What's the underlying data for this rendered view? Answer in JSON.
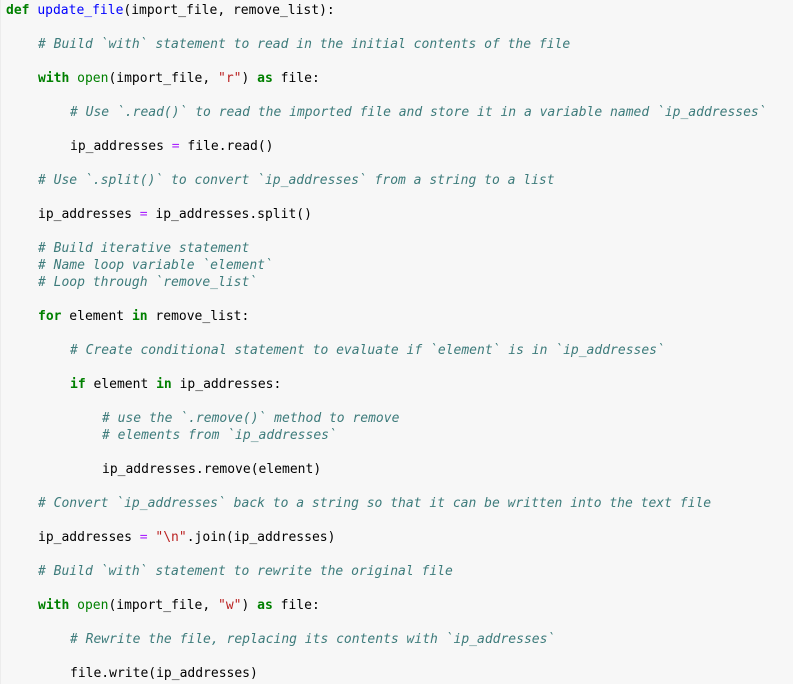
{
  "code_cell": {
    "language": "python",
    "lines": [
      {
        "indent": 0,
        "parts": [
          {
            "t": "kw",
            "v": "def"
          },
          {
            "t": "plain",
            "v": " "
          },
          {
            "t": "fn",
            "v": "update_file"
          },
          {
            "t": "plain",
            "v": "(import_file, remove_list):"
          }
        ]
      },
      {
        "indent": 1,
        "parts": [
          {
            "t": "cm",
            "v": "# Build `with` statement to read in the initial contents of the file"
          }
        ]
      },
      {
        "indent": 1,
        "parts": [
          {
            "t": "kw",
            "v": "with"
          },
          {
            "t": "plain",
            "v": " "
          },
          {
            "t": "bi",
            "v": "open"
          },
          {
            "t": "plain",
            "v": "(import_file, "
          },
          {
            "t": "str",
            "v": "\"r\""
          },
          {
            "t": "plain",
            "v": ") "
          },
          {
            "t": "kw",
            "v": "as"
          },
          {
            "t": "plain",
            "v": " file:"
          }
        ]
      },
      {
        "indent": 2,
        "parts": [
          {
            "t": "cm",
            "v": "# Use `.read()` to read the imported file and store it in a variable named `ip_addresses`"
          }
        ]
      },
      {
        "indent": 2,
        "parts": [
          {
            "t": "plain",
            "v": "ip_addresses "
          },
          {
            "t": "op",
            "v": "="
          },
          {
            "t": "plain",
            "v": " file.read()"
          }
        ]
      },
      {
        "indent": 1,
        "parts": [
          {
            "t": "cm",
            "v": "# Use `.split()` to convert `ip_addresses` from a string to a list"
          }
        ]
      },
      {
        "indent": 1,
        "parts": [
          {
            "t": "plain",
            "v": "ip_addresses "
          },
          {
            "t": "op",
            "v": "="
          },
          {
            "t": "plain",
            "v": " ip_addresses.split()"
          }
        ]
      },
      {
        "indent": 1,
        "parts": [
          {
            "t": "cm",
            "v": "# Build iterative statement"
          }
        ]
      },
      {
        "indent": 1,
        "parts": [
          {
            "t": "cm",
            "v": "# Name loop variable `element`"
          }
        ]
      },
      {
        "indent": 1,
        "parts": [
          {
            "t": "cm",
            "v": "# Loop through `remove_list`"
          }
        ]
      },
      {
        "indent": 1,
        "parts": [
          {
            "t": "kw",
            "v": "for"
          },
          {
            "t": "plain",
            "v": " element "
          },
          {
            "t": "kw",
            "v": "in"
          },
          {
            "t": "plain",
            "v": " remove_list:"
          }
        ]
      },
      {
        "indent": 2,
        "parts": [
          {
            "t": "cm",
            "v": "# Create conditional statement to evaluate if `element` is in `ip_addresses`"
          }
        ]
      },
      {
        "indent": 2,
        "parts": [
          {
            "t": "kw",
            "v": "if"
          },
          {
            "t": "plain",
            "v": " element "
          },
          {
            "t": "kw",
            "v": "in"
          },
          {
            "t": "plain",
            "v": " ip_addresses:"
          }
        ]
      },
      {
        "indent": 3,
        "parts": [
          {
            "t": "cm",
            "v": "# use the `.remove()` method to remove"
          }
        ]
      },
      {
        "indent": 3,
        "parts": [
          {
            "t": "cm",
            "v": "# elements from `ip_addresses`"
          }
        ]
      },
      {
        "indent": 3,
        "parts": [
          {
            "t": "plain",
            "v": "ip_addresses.remove(element)"
          }
        ]
      },
      {
        "indent": 1,
        "parts": [
          {
            "t": "cm",
            "v": "# Convert `ip_addresses` back to a string so that it can be written into the text file"
          }
        ]
      },
      {
        "indent": 1,
        "parts": [
          {
            "t": "plain",
            "v": "ip_addresses "
          },
          {
            "t": "op",
            "v": "="
          },
          {
            "t": "plain",
            "v": " "
          },
          {
            "t": "str",
            "v": "\"\\n\""
          },
          {
            "t": "plain",
            "v": ".join(ip_addresses)"
          }
        ]
      },
      {
        "indent": 1,
        "parts": [
          {
            "t": "cm",
            "v": "# Build `with` statement to rewrite the original file"
          }
        ]
      },
      {
        "indent": 1,
        "parts": [
          {
            "t": "kw",
            "v": "with"
          },
          {
            "t": "plain",
            "v": " "
          },
          {
            "t": "bi",
            "v": "open"
          },
          {
            "t": "plain",
            "v": "(import_file, "
          },
          {
            "t": "str",
            "v": "\"w\""
          },
          {
            "t": "plain",
            "v": ") "
          },
          {
            "t": "kw",
            "v": "as"
          },
          {
            "t": "plain",
            "v": " file:"
          }
        ]
      },
      {
        "indent": 2,
        "parts": [
          {
            "t": "cm",
            "v": "# Rewrite the file, replacing its contents with `ip_addresses`"
          }
        ]
      },
      {
        "indent": 2,
        "parts": [
          {
            "t": "plain",
            "v": "file.write(ip_addresses)"
          }
        ]
      }
    ]
  },
  "colors": {
    "background": "#f7f7f7",
    "keyword": "#008000",
    "function_name": "#0000ff",
    "string": "#ba2121",
    "operator": "#aa22ff",
    "comment": "#3d7b7b",
    "text": "#000000"
  }
}
